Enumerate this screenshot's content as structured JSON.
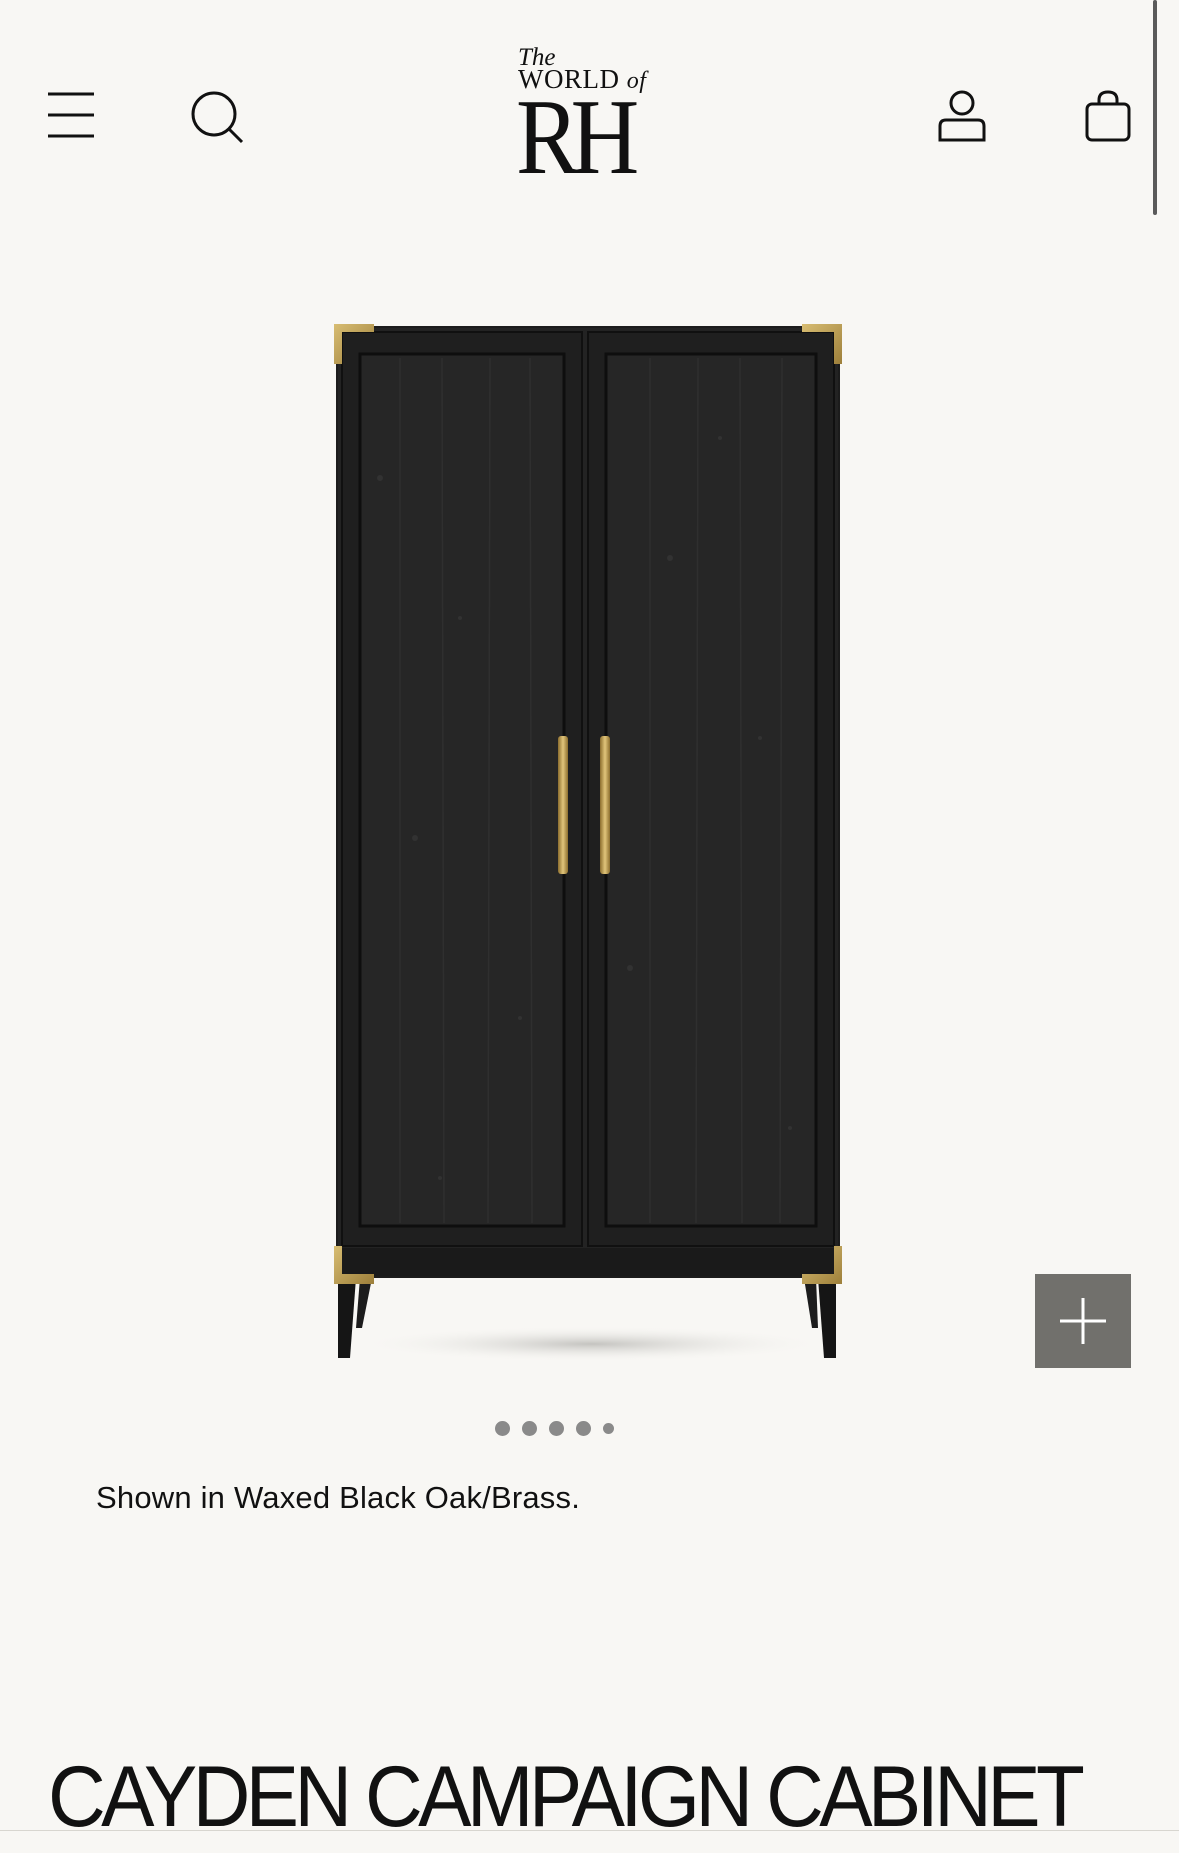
{
  "header": {
    "logo": {
      "the": "The",
      "world": "WORLD",
      "of": "of",
      "rh": "RH"
    },
    "icons": {
      "menu": "menu-icon",
      "search": "search-icon",
      "account": "account-icon",
      "cart": "cart-icon"
    }
  },
  "gallery": {
    "image_subject": "two-door black oak cabinet with brass corner caps and handles",
    "dot_count": 5,
    "active_dot": 0,
    "zoom_icon": "plus-icon"
  },
  "caption": "Shown in Waxed Black Oak/Brass.",
  "product": {
    "title": "CAYDEN CAMPAIGN CABINET"
  },
  "colors": {
    "background": "#f8f7f4",
    "zoom_button": "#71706c",
    "wood": "#1e1e1e",
    "brass": "#b89a4f"
  }
}
